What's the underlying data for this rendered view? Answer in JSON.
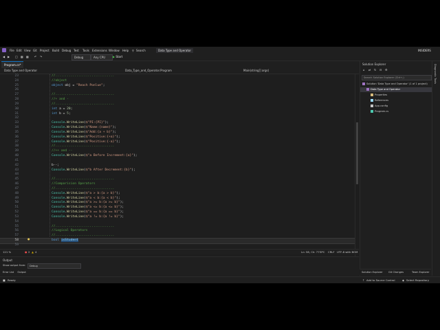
{
  "menubar": {
    "items": [
      "File",
      "Edit",
      "View",
      "Git",
      "Project",
      "Build",
      "Debug",
      "Test",
      "Tools",
      "Extensions",
      "Window",
      "Help"
    ],
    "search_label": "Search",
    "solution_name": "Data Type and Operator",
    "user_badge": "INSIDERS"
  },
  "toolbar": {
    "config": "Debug",
    "platform": "Any CPU",
    "run_label": "Start"
  },
  "tab": {
    "label": "Program.cs*"
  },
  "navbar": {
    "project": "Data Type and Operator",
    "class": "Data_Type_and_Operator.Program",
    "member": "Main(string[] args)"
  },
  "code": {
    "lines": [
      {
        "n": "23",
        "t": "//..............................."
      },
      {
        "n": "24",
        "t": "//object"
      },
      {
        "n": "25",
        "t": "object obj = \"Reach Ponlue\";"
      },
      {
        "n": "26",
        "t": ""
      },
      {
        "n": "27",
        "t": "//..............................."
      },
      {
        "n": "28",
        "t": "//+ and -"
      },
      {
        "n": "29",
        "t": "//..............................."
      },
      {
        "n": "30",
        "t": "int a = 20;"
      },
      {
        "n": "31",
        "t": "int b = 5;"
      },
      {
        "n": "32",
        "t": ""
      },
      {
        "n": "33",
        "t": "Console.WriteLine($\"PI:{PI}\");"
      },
      {
        "n": "34",
        "t": "Console.WriteLine($\"Name:{name}\");"
      },
      {
        "n": "35",
        "t": "Console.WriteLine($\"Add:{a + b}\");"
      },
      {
        "n": "36",
        "t": "Console.WriteLine($\"Positive:{+a}\");"
      },
      {
        "n": "37",
        "t": "Console.WriteLine($\"Positive:{-a}\");"
      },
      {
        "n": "38",
        "t": "//..............................."
      },
      {
        "n": "39",
        "t": "//++ and --"
      },
      {
        "n": "40",
        "t": "Console.WriteLine($\"a Before Increment:{a}\");"
      },
      {
        "n": "41",
        "t": ""
      },
      {
        "n": "42",
        "t": "b--;"
      },
      {
        "n": "43",
        "t": "Console.WriteLine($\"b After Decrement:{b}\");"
      },
      {
        "n": "44",
        "t": ""
      },
      {
        "n": "45",
        "t": "//..............................."
      },
      {
        "n": "46",
        "t": "//Comparision Operators"
      },
      {
        "n": "47",
        "t": "//..............................."
      },
      {
        "n": "48",
        "t": "Console.WriteLine($\"a > b:{a > b}\");"
      },
      {
        "n": "49",
        "t": "Console.WriteLine($\"a < b:{a < b}\");"
      },
      {
        "n": "50",
        "t": "Console.WriteLine($\"a >= b:{a >= b}\");"
      },
      {
        "n": "51",
        "t": "Console.WriteLine($\"a <= b:{a <= b}\");"
      },
      {
        "n": "52",
        "t": "Console.WriteLine($\"a == b:{a == b}\");"
      },
      {
        "n": "53",
        "t": "Console.WriteLine($\"a != b:{a != b}\");"
      },
      {
        "n": "54",
        "t": ""
      },
      {
        "n": "55",
        "t": "//..............................."
      },
      {
        "n": "56",
        "t": "//Logical Operators"
      },
      {
        "n": "57",
        "t": "//..............................."
      },
      {
        "n": "58",
        "t": "bool isStudent"
      },
      {
        "n": "59",
        "t": ""
      }
    ],
    "current_line": "58"
  },
  "status": {
    "zoom": "121 %",
    "errors": "2",
    "warnings": "4",
    "position": "Ln: 58, Ch: 77",
    "spaces": "SPC",
    "eol": "CRLF",
    "encoding": "UTF-8 with BOM"
  },
  "solution_explorer": {
    "title": "Solution Explorer",
    "search_placeholder": "Search Solution Explorer (Ctrl+;)",
    "items": [
      {
        "label": "Solution 'Data Type and Operator' (1 of 1 project)",
        "level": 0
      },
      {
        "label": "Data Type and Operator",
        "level": 1
      },
      {
        "label": "Properties",
        "level": 2
      },
      {
        "label": "References",
        "level": 2
      },
      {
        "label": "App.config",
        "level": 2
      },
      {
        "label": "Program.cs",
        "level": 2
      }
    ],
    "bottom_tabs": [
      "Solution Explorer",
      "Git Changes",
      "Team Explorer"
    ]
  },
  "side_tabs": {
    "label": "Diagnostic Tools"
  },
  "output": {
    "title": "Output",
    "show_from_label": "Show output from:",
    "show_from_value": "Debug",
    "tabs": [
      "Error List",
      "Output"
    ]
  },
  "statusbar": {
    "ready": "Ready",
    "add_source_control": "Add to Source Control",
    "select_repository": "Select Repository"
  },
  "colors": {
    "accent": "#0e70c0",
    "comment": "#57a64a",
    "keyword": "#569cd6",
    "type": "#4ec9b0",
    "method": "#dcdcaa",
    "string": "#d69d85"
  }
}
